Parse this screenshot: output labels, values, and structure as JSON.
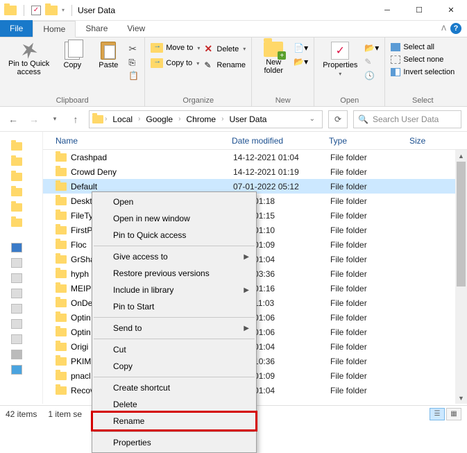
{
  "window": {
    "title": "User Data"
  },
  "tabs": {
    "file": "File",
    "home": "Home",
    "share": "Share",
    "view": "View"
  },
  "ribbon": {
    "clipboard": {
      "label": "Clipboard",
      "pin": "Pin to Quick\naccess",
      "copy": "Copy",
      "paste": "Paste"
    },
    "organize": {
      "label": "Organize",
      "moveto": "Move to",
      "copyto": "Copy to",
      "delete": "Delete",
      "rename": "Rename"
    },
    "new": {
      "label": "New",
      "newfolder": "New\nfolder"
    },
    "open": {
      "label": "Open",
      "properties": "Properties"
    },
    "select": {
      "label": "Select",
      "selectall": "Select all",
      "selectnone": "Select none",
      "invert": "Invert selection"
    }
  },
  "breadcrumb": {
    "a": "Local",
    "b": "Google",
    "c": "Chrome",
    "d": "User Data"
  },
  "search": {
    "placeholder": "Search User Data"
  },
  "columns": {
    "name": "Name",
    "date": "Date modified",
    "type": "Type",
    "size": "Size"
  },
  "items": [
    {
      "name": "Crashpad",
      "name_trunc": "Crashpad",
      "date": "14-12-2021 01:04",
      "date_trunc": "14-12-2021 01:04",
      "type": "File folder",
      "selected": false
    },
    {
      "name": "Crowd Deny",
      "name_trunc": "Crowd Deny",
      "date": "14-12-2021 01:19",
      "date_trunc": "14-12-2021 01:19",
      "type": "File folder",
      "selected": false
    },
    {
      "name": "Default",
      "name_trunc": "Default",
      "date": "07-01-2022 05:12",
      "date_trunc": "07-01-2022 05:12",
      "type": "File folder",
      "selected": true
    },
    {
      "name": "Desktop",
      "name_trunc": "Deskt",
      "date": "14-12-2021 01:18",
      "date_trunc": "2021 01:18",
      "type": "File folder",
      "selected": false
    },
    {
      "name": "FileTypePolicies",
      "name_trunc": "FileTy",
      "date": "14-12-2021 01:15",
      "date_trunc": "2021 01:15",
      "type": "File folder",
      "selected": false
    },
    {
      "name": "FirstPartySets",
      "name_trunc": "FirstP",
      "date": "14-12-2021 01:10",
      "date_trunc": "2021 01:10",
      "type": "File folder",
      "selected": false
    },
    {
      "name": "Floc",
      "name_trunc": "Floc",
      "date": "14-12-2021 01:09",
      "date_trunc": "2021 01:09",
      "type": "File folder",
      "selected": false
    },
    {
      "name": "GrShaderCache",
      "name_trunc": "GrSha",
      "date": "14-12-2021 01:04",
      "date_trunc": "2021 01:04",
      "type": "File folder",
      "selected": false
    },
    {
      "name": "hyphen-data",
      "name_trunc": "hyph",
      "date": "07-01-2022 03:36",
      "date_trunc": "2022 03:36",
      "type": "File folder",
      "selected": false
    },
    {
      "name": "MEIPreload",
      "name_trunc": "MEIP",
      "date": "14-12-2021 01:16",
      "date_trunc": "2021 01:16",
      "type": "File folder",
      "selected": false
    },
    {
      "name": "OnDeviceHeadSuggestModel",
      "name_trunc": "OnDe",
      "date": "07-01-2022 11:03",
      "date_trunc": "2022 11:03",
      "type": "File folder",
      "selected": false
    },
    {
      "name": "OptimizationGuidePredictionModels",
      "name_trunc": "Optin",
      "date": "14-12-2021 01:06",
      "date_trunc": "2021 01:06",
      "type": "File folder",
      "selected": false
    },
    {
      "name": "OptimizationHints",
      "name_trunc": "Optin",
      "date": "14-12-2021 01:06",
      "date_trunc": "2021 01:06",
      "type": "File folder",
      "selected": false
    },
    {
      "name": "OriginTrials",
      "name_trunc": "Origi",
      "date": "14-12-2021 01:04",
      "date_trunc": "2021 01:04",
      "type": "File folder",
      "selected": false
    },
    {
      "name": "PKIMetadata",
      "name_trunc": "PKIM",
      "date": "07-01-2022 10:36",
      "date_trunc": "2022 10:36",
      "type": "File folder",
      "selected": false
    },
    {
      "name": "pnacl",
      "name_trunc": "pnacl",
      "date": "14-12-2021 01:09",
      "date_trunc": "2021 01:09",
      "type": "File folder",
      "selected": false
    },
    {
      "name": "RecoveryImproved",
      "name_trunc": "Recov",
      "date": "14-12-2021 01:04",
      "date_trunc": "2021 01:04",
      "type": "File folder",
      "selected": false
    }
  ],
  "context": {
    "open": "Open",
    "opennew": "Open in new window",
    "pinquick": "Pin to Quick access",
    "giveaccess": "Give access to",
    "restore": "Restore previous versions",
    "include": "Include in library",
    "pinstart": "Pin to Start",
    "sendto": "Send to",
    "cut": "Cut",
    "copy": "Copy",
    "shortcut": "Create shortcut",
    "delete": "Delete",
    "rename": "Rename",
    "properties": "Properties"
  },
  "status": {
    "count": "42 items",
    "selected": "1 item se"
  }
}
